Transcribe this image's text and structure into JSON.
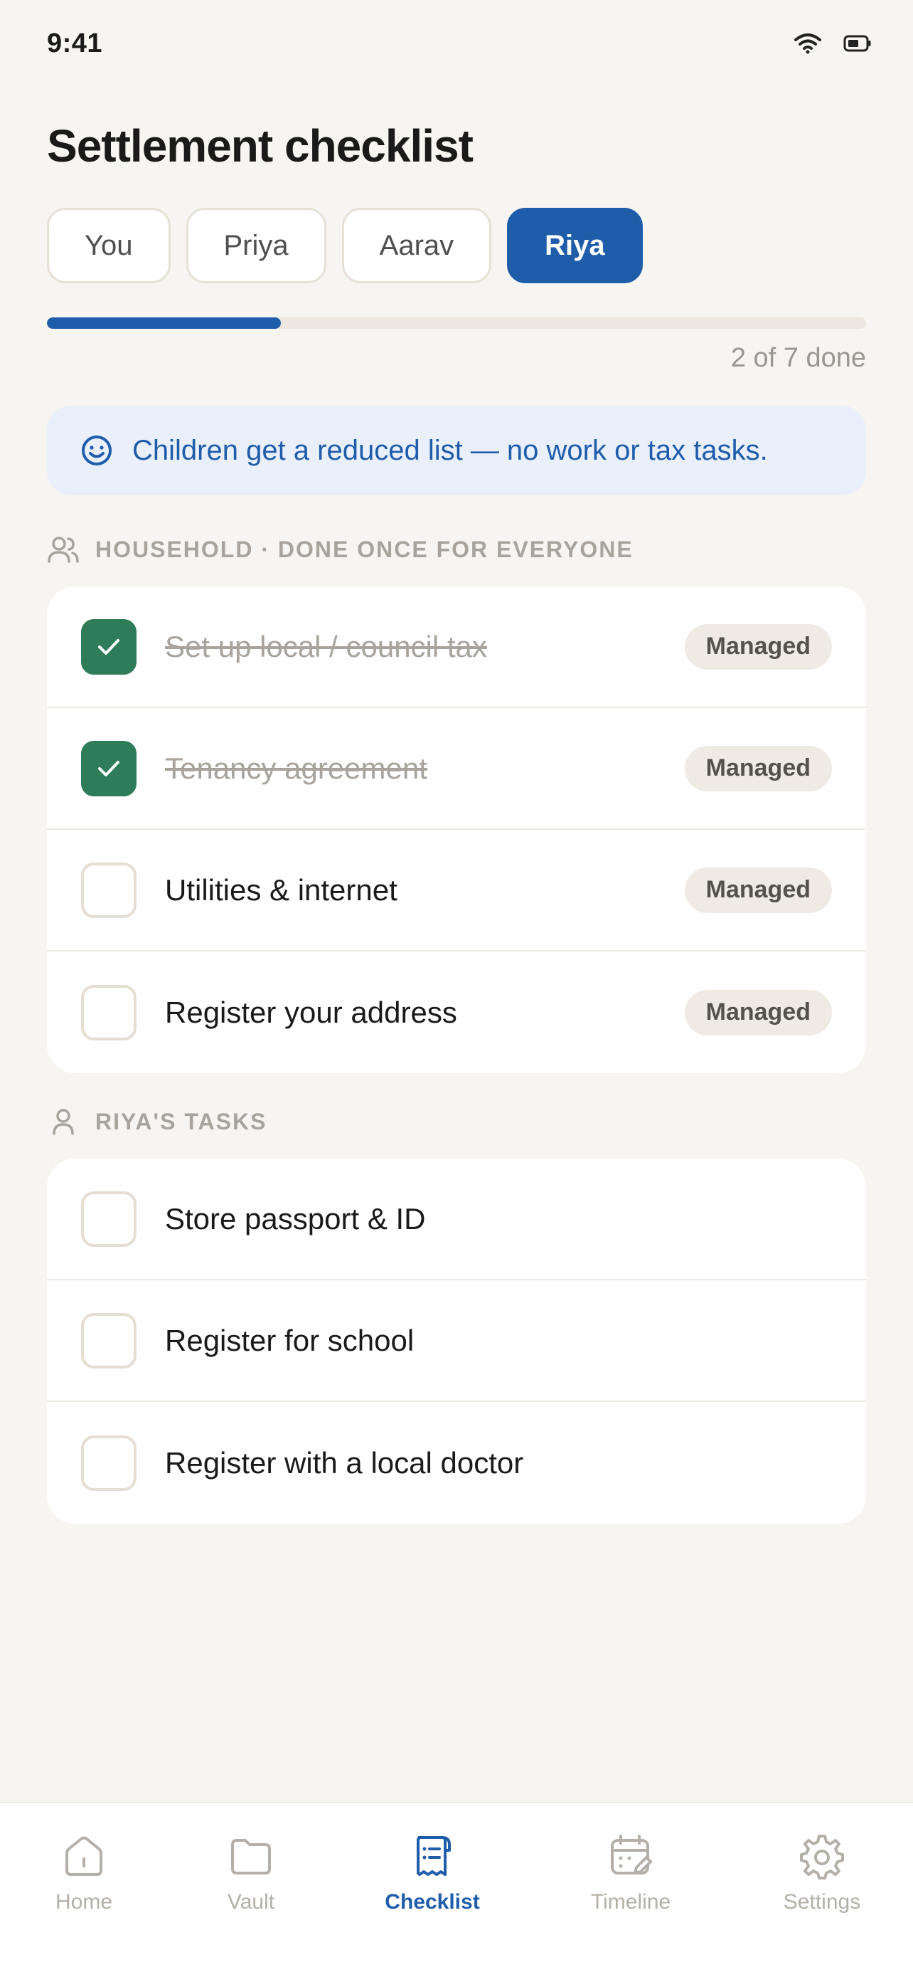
{
  "status_bar": {
    "time": "9:41"
  },
  "page_title": "Settlement checklist",
  "members": [
    {
      "label": "You",
      "active": false
    },
    {
      "label": "Priya",
      "active": false
    },
    {
      "label": "Aarav",
      "active": false
    },
    {
      "label": "Riya",
      "active": true
    }
  ],
  "progress": {
    "done": 2,
    "total": 7,
    "text": "2 of 7 done"
  },
  "info_banner": {
    "icon": "smile-icon",
    "text": "Children get a reduced list — no work or tax tasks."
  },
  "household": {
    "label": "HOUSEHOLD · DONE ONCE FOR EVERYONE",
    "icon": "users-icon",
    "items": [
      {
        "label": "Set up local / council tax",
        "done": true,
        "badge": "Managed"
      },
      {
        "label": "Tenancy agreement",
        "done": true,
        "badge": "Managed"
      },
      {
        "label": "Utilities & internet",
        "done": false,
        "badge": "Managed"
      },
      {
        "label": "Register your address",
        "done": false,
        "badge": "Managed"
      }
    ]
  },
  "personal": {
    "label": "RIYA'S TASKS",
    "icon": "user-icon",
    "items": [
      {
        "label": "Store passport & ID",
        "done": false
      },
      {
        "label": "Register for school",
        "done": false
      },
      {
        "label": "Register with a local doctor",
        "done": false
      }
    ]
  },
  "tabbar": [
    {
      "label": "Home",
      "icon": "home-icon",
      "active": false
    },
    {
      "label": "Vault",
      "icon": "folder-icon",
      "active": false
    },
    {
      "label": "Checklist",
      "icon": "checklist-icon",
      "active": true
    },
    {
      "label": "Timeline",
      "icon": "calendar-icon",
      "active": false
    },
    {
      "label": "Settings",
      "icon": "gear-icon",
      "active": false
    }
  ],
  "colors": {
    "accent": "#1F5DAA",
    "success": "#2E7D58",
    "background": "#F6F5F1"
  }
}
